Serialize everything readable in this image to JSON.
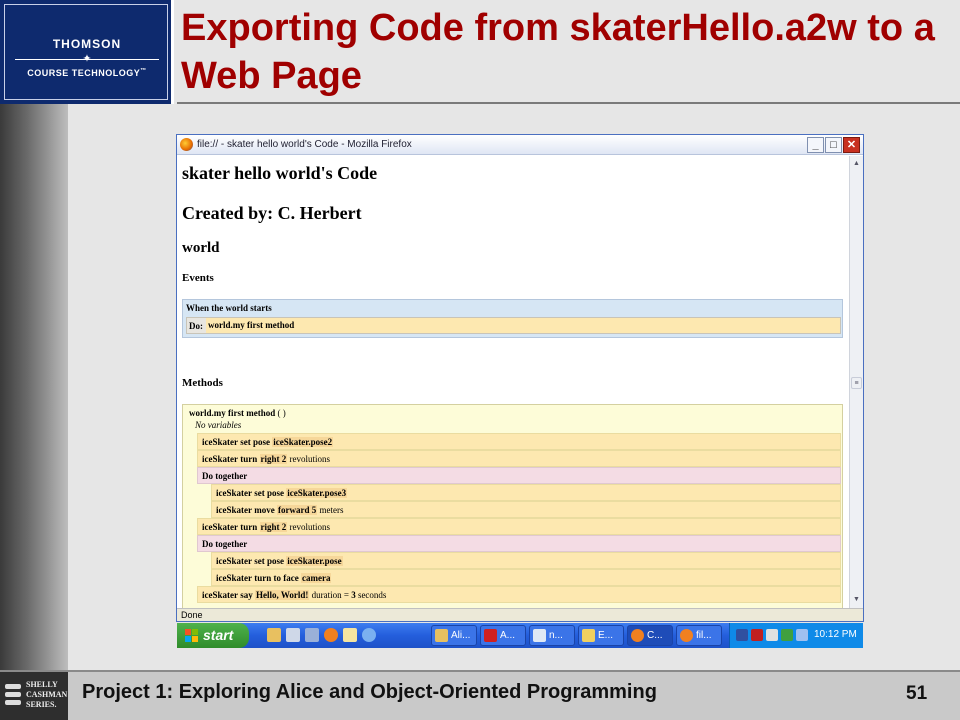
{
  "slide": {
    "title": "Exporting Code from skaterHello.a2w to a Web Page",
    "logo_top": "THOMSON",
    "logo_bottom": "COURSE TECHNOLOGY",
    "logo_tm": "™",
    "footer_text": "Project 1: Exploring Alice and Object-Oriented Programming",
    "page_number": "51",
    "series_logo": [
      "SHELLY",
      "CASHMAN",
      "SERIES."
    ]
  },
  "browser": {
    "window_title": "file:// - skater hello world's Code - Mozilla Firefox",
    "status": "Done",
    "page": {
      "heading": "skater hello world's Code",
      "created_by": "Created by: C. Herbert",
      "object": "world",
      "events_label": "Events",
      "event_trigger": "When the world starts",
      "event_do_label": "Do:",
      "event_do_value": "world.my first method",
      "methods_label": "Methods",
      "method_name": "world.my first method",
      "method_parens": "( )",
      "no_variables": "No variables",
      "rows": [
        {
          "kind": "instr",
          "indent": 1,
          "obj": "iceSkater",
          "verb": "set pose",
          "arg": "iceSkater.pose2",
          "extra": ""
        },
        {
          "kind": "instr",
          "indent": 1,
          "obj": "iceSkater",
          "verb": "turn",
          "arg": "right 2",
          "extra": "revolutions"
        },
        {
          "kind": "dotog",
          "indent": 1,
          "label": "Do together"
        },
        {
          "kind": "instr",
          "indent": 2,
          "obj": "iceSkater",
          "verb": "set pose",
          "arg": "iceSkater.pose3",
          "extra": ""
        },
        {
          "kind": "instr",
          "indent": 2,
          "obj": "iceSkater",
          "verb": "move",
          "arg": "forward 5",
          "extra": "meters"
        },
        {
          "kind": "instr",
          "indent": 1,
          "obj": "iceSkater",
          "verb": "turn",
          "arg": "right 2",
          "extra": "revolutions"
        },
        {
          "kind": "dotog",
          "indent": 1,
          "label": "Do together"
        },
        {
          "kind": "instr",
          "indent": 2,
          "obj": "iceSkater",
          "verb": "set pose",
          "arg": "iceSkater.pose",
          "extra": ""
        },
        {
          "kind": "instr",
          "indent": 2,
          "obj": "iceSkater",
          "verb": "turn to face",
          "arg": "camera",
          "extra": ""
        },
        {
          "kind": "instr",
          "indent": 1,
          "obj": "iceSkater",
          "verb": "say",
          "arg": "Hello, World!",
          "extra": "duration =",
          "extra2": "3",
          "extra3": "seconds"
        }
      ]
    }
  },
  "taskbar": {
    "start_label": "start",
    "tasks": [
      "Ali...",
      "A...",
      "n...",
      "E...",
      "C...",
      "fil..."
    ],
    "clock": "10:12 PM"
  },
  "colors": {
    "title_red": "#a00000",
    "events_blue": "#d6e6f4",
    "instr_orange": "#fde8b0",
    "dotogether_pink": "#f4dce4",
    "method_yellow": "#fdfcd8",
    "taskbar_blue": "#245edc",
    "start_green": "#2f8c2a"
  }
}
